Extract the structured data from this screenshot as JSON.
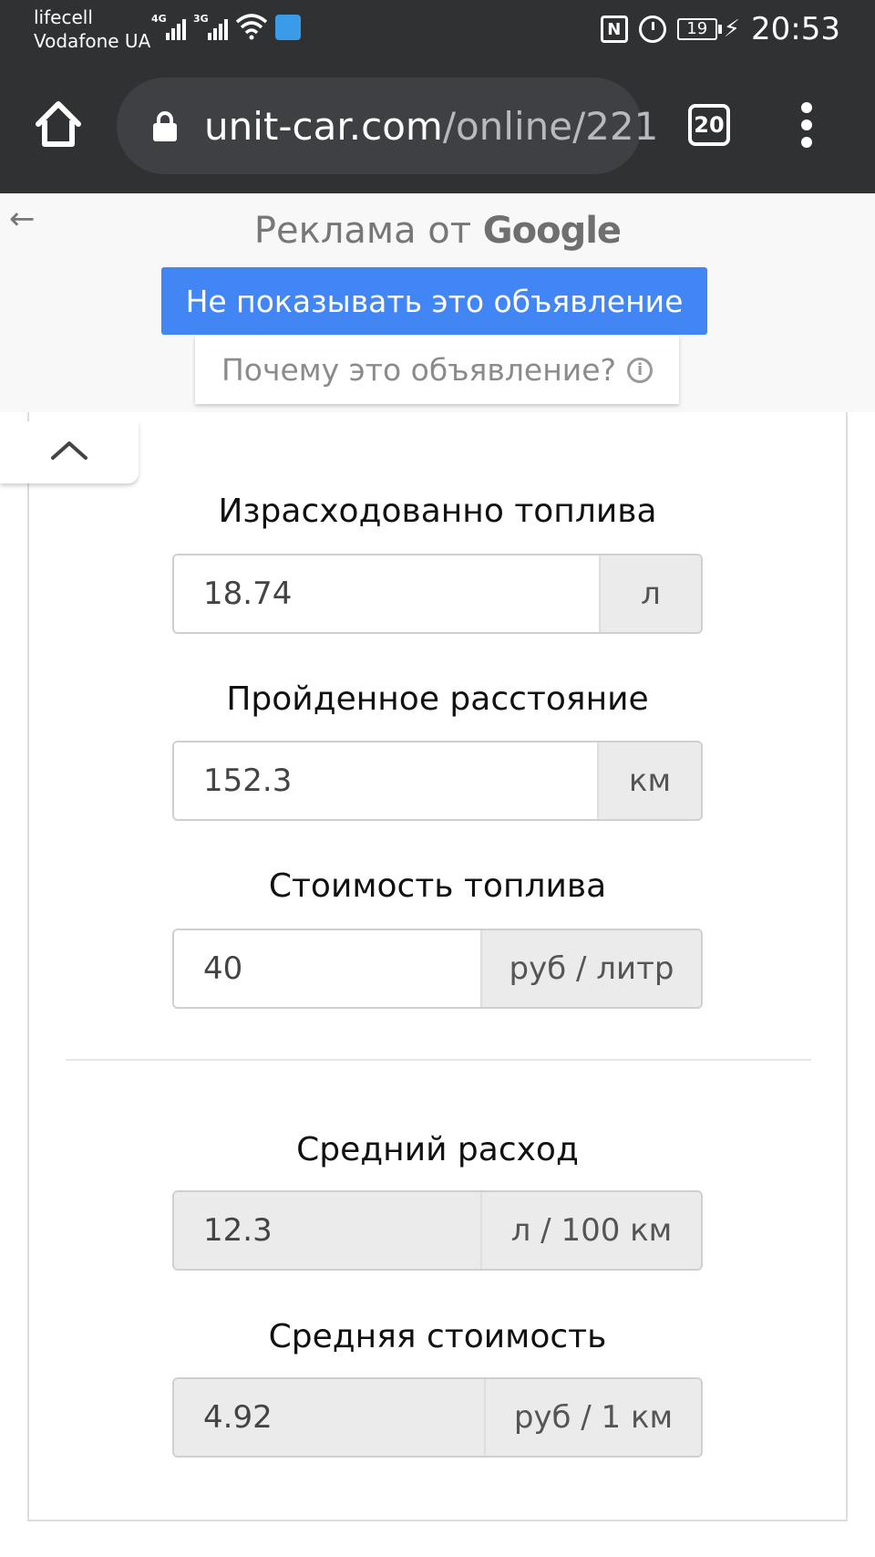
{
  "status_bar": {
    "carrier_1": "lifecell",
    "carrier_2": "Vodafone UA",
    "net_1": "4G",
    "net_2": "3G",
    "nfc_label": "N",
    "battery_level": "19",
    "time": "20:53"
  },
  "browser": {
    "url_host": "unit-car.com",
    "url_path": "/online/221",
    "tab_count": "20"
  },
  "ad": {
    "label_prefix": "Реклама от",
    "label_brand": "Google",
    "hide_button": "Не показывать это объявление",
    "why_button": "Почему это объявление?"
  },
  "calculator": {
    "fuel_used": {
      "label": "Израсходованно топлива",
      "value": "18.74",
      "unit": "л"
    },
    "distance": {
      "label": "Пройденное расстояние",
      "value": "152.3",
      "unit": "км"
    },
    "fuel_price": {
      "label": "Стоимость топлива",
      "value": "40",
      "unit": "руб / литр"
    },
    "avg_consumption": {
      "label": "Средний расход",
      "value": "12.3",
      "unit": "л / 100 км"
    },
    "avg_cost": {
      "label": "Средняя стоимость",
      "value": "4.92",
      "unit": "руб / 1 км"
    }
  },
  "colors": {
    "chrome_dark": "#303133",
    "ad_button_blue": "#4285f4",
    "addon_gray": "#ebebeb"
  }
}
